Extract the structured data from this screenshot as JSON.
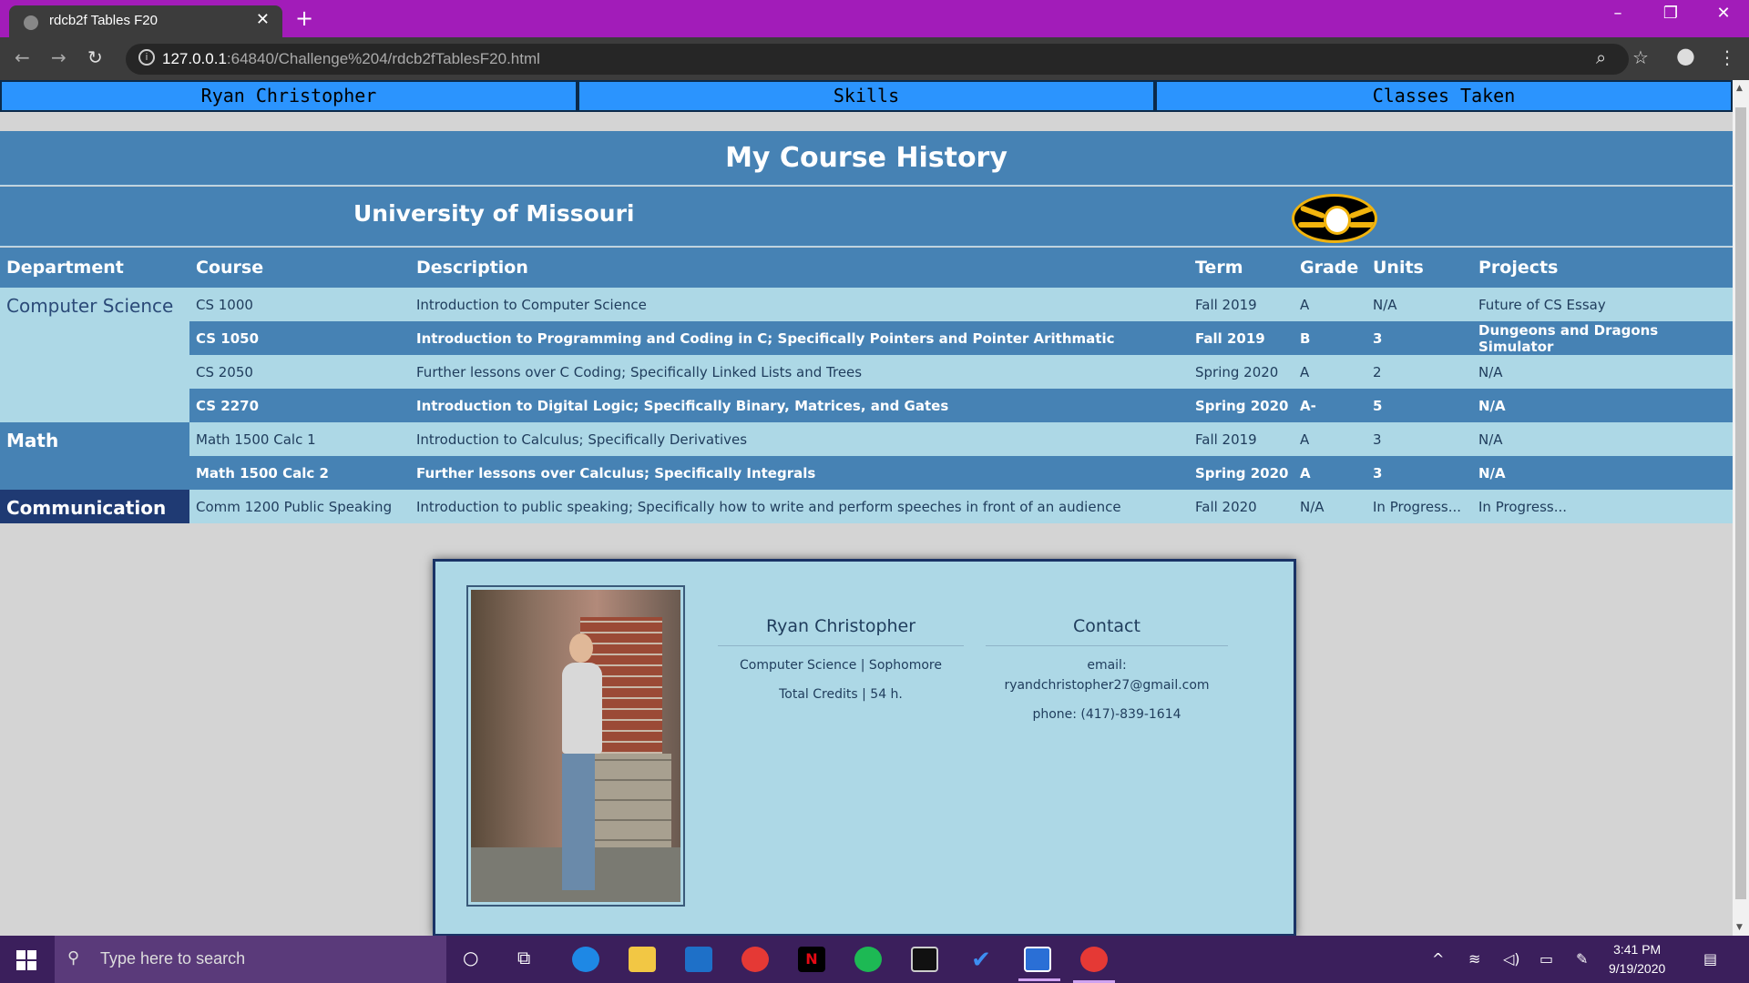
{
  "browser": {
    "tab_title": "rdcb2f Tables F20",
    "new_tab_icon": "plus-icon",
    "url_host": "127.0.0.1",
    "url_rest": ":64840/Challenge%204/rdcb2fTablesF20.html"
  },
  "nav": {
    "items": [
      "Ryan Christopher",
      "Skills",
      "Classes Taken"
    ]
  },
  "page": {
    "title": "My Course History",
    "university": "University of Missouri"
  },
  "table": {
    "headers": [
      "Department",
      "Course",
      "Description",
      "Term",
      "Grade",
      "Units",
      "Projects"
    ],
    "departments": {
      "cs": "Computer Science",
      "math": "Math",
      "comm": "Communication"
    },
    "rows": [
      {
        "course": "CS 1000",
        "description": "Introduction to Computer Science",
        "term": "Fall 2019",
        "grade": "A",
        "units": "N/A",
        "projects": "Future of CS Essay"
      },
      {
        "course": "CS 1050",
        "description": "Introduction to Programming and Coding in C; Specifically Pointers and Pointer Arithmatic",
        "term": "Fall 2019",
        "grade": "B",
        "units": "3",
        "projects": "Dungeons and Dragons Simulator"
      },
      {
        "course": "CS 2050",
        "description": "Further lessons over C Coding; Specifically Linked Lists and Trees",
        "term": "Spring 2020",
        "grade": "A",
        "units": "2",
        "projects": "N/A"
      },
      {
        "course": "CS 2270",
        "description": "Introduction to Digital Logic; Specifically Binary, Matrices, and Gates",
        "term": "Spring 2020",
        "grade": "A-",
        "units": "5",
        "projects": "N/A"
      },
      {
        "course": "Math 1500 Calc 1",
        "description": "Introduction to Calculus; Specifically Derivatives",
        "term": "Fall 2019",
        "grade": "A",
        "units": "3",
        "projects": "N/A"
      },
      {
        "course": "Math 1500 Calc 2",
        "description": "Further lessons over Calculus; Specifically Integrals",
        "term": "Spring 2020",
        "grade": "A",
        "units": "3",
        "projects": "N/A"
      },
      {
        "course": "Comm 1200 Public Speaking",
        "description": "Introduction to public speaking; Specifically how to write and perform speeches in front of an audience",
        "term": "Fall 2020",
        "grade": "N/A",
        "units": "In Progress...",
        "projects": "In Progress..."
      }
    ]
  },
  "profile": {
    "name": "Ryan Christopher",
    "major": "Computer Science | Sophomore",
    "credits": "Total Credits | 54 h.",
    "contact_title": "Contact",
    "email_label": "email:",
    "email": "ryandchristopher27@gmail.com",
    "phone": "phone: (417)-839-1614"
  },
  "taskbar": {
    "search_placeholder": "Type here to search",
    "time": "3:41 PM",
    "date": "9/19/2020"
  },
  "colors": {
    "chrome_frame": "#a21cb9",
    "nav_blue": "#2b94fe",
    "steel_blue": "#4682b4",
    "light_blue": "#add8e6",
    "navy": "#1f3a73"
  }
}
